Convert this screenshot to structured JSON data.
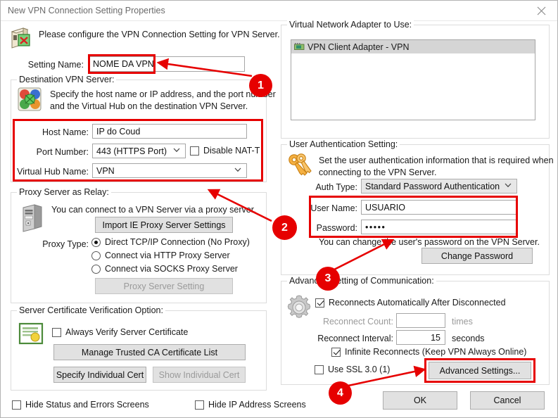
{
  "window": {
    "title": "New VPN Connection Setting Properties",
    "close_icon": "close-icon"
  },
  "header": {
    "icon": "vpn-connection-icon",
    "description": "Please configure the VPN Connection Setting for VPN Server."
  },
  "setting_name": {
    "label": "Setting Name:",
    "value": "NOME DA VPN"
  },
  "destination": {
    "group_title": "Destination VPN Server:",
    "icon": "hub-servers-icon",
    "description_line1": "Specify the host name or IP address, and the port number",
    "description_line2": "and the Virtual Hub on the destination VPN Server.",
    "host_name_label": "Host Name:",
    "host_name_value": "IP do Coud",
    "port_number_label": "Port Number:",
    "port_number_value": "443 (HTTPS Port)",
    "disable_nat_t_label": "Disable NAT-T",
    "disable_nat_t_checked": false,
    "virtual_hub_label": "Virtual Hub Name:",
    "virtual_hub_value": "VPN"
  },
  "proxy": {
    "group_title": "Proxy Server as Relay:",
    "icon": "server-tower-icon",
    "description": "You can connect to a VPN Server via a proxy server.",
    "import_button": "Import IE Proxy Server Settings",
    "proxy_type_label": "Proxy Type:",
    "options": [
      {
        "label": "Direct TCP/IP Connection (No Proxy)",
        "selected": true
      },
      {
        "label": "Connect via HTTP Proxy Server",
        "selected": false
      },
      {
        "label": "Connect via SOCKS Proxy Server",
        "selected": false
      }
    ],
    "proxy_setting_button": "Proxy Server Setting",
    "proxy_setting_disabled": true
  },
  "certificate": {
    "group_title": "Server Certificate Verification Option:",
    "icon": "certificate-icon",
    "always_verify_label": "Always Verify Server Certificate",
    "always_verify_checked": false,
    "manage_ca_button": "Manage Trusted CA Certificate List",
    "specify_cert_button": "Specify Individual Cert",
    "show_cert_button": "Show Individual Cert",
    "show_cert_disabled": true
  },
  "adapter": {
    "group_title": "Virtual Network Adapter to Use:",
    "items": [
      {
        "icon": "network-adapter-icon",
        "label": "VPN Client Adapter - VPN",
        "selected": true
      }
    ]
  },
  "auth": {
    "group_title": "User Authentication Setting:",
    "icon": "keys-icon",
    "description_line1": "Set the user authentication information that is required when",
    "description_line2": "connecting to the VPN Server.",
    "auth_type_label": "Auth Type:",
    "auth_type_value": "Standard Password Authentication",
    "user_name_label": "User Name:",
    "user_name_value": "USUARIO",
    "password_label": "Password:",
    "password_value": "•••••",
    "hint": "You can change the user's password on the VPN Server.",
    "change_password_button": "Change Password"
  },
  "advanced": {
    "group_title": "Advanced Setting of Communication:",
    "icon": "gear-icon",
    "reconnect_auto_label": "Reconnects Automatically After Disconnected",
    "reconnect_auto_checked": true,
    "reconnect_count_label": "Reconnect Count:",
    "reconnect_count_value": "",
    "times_label": "times",
    "reconnect_interval_label": "Reconnect Interval:",
    "reconnect_interval_value": "15",
    "seconds_label": "seconds",
    "infinite_label": "Infinite Reconnects (Keep VPN Always Online)",
    "infinite_checked": true,
    "use_ssl3_label": "Use SSL 3.0 (1)",
    "use_ssl3_checked": false,
    "advanced_settings_button": "Advanced Settings..."
  },
  "footer": {
    "hide_status_label": "Hide Status and Errors Screens",
    "hide_status_checked": false,
    "hide_ip_label": "Hide IP Address Screens",
    "hide_ip_checked": false,
    "ok_button": "OK",
    "cancel_button": "Cancel"
  },
  "annotations": {
    "accent_color": "#e60000",
    "markers": [
      {
        "number": "1"
      },
      {
        "number": "2"
      },
      {
        "number": "3"
      },
      {
        "number": "4"
      }
    ]
  }
}
